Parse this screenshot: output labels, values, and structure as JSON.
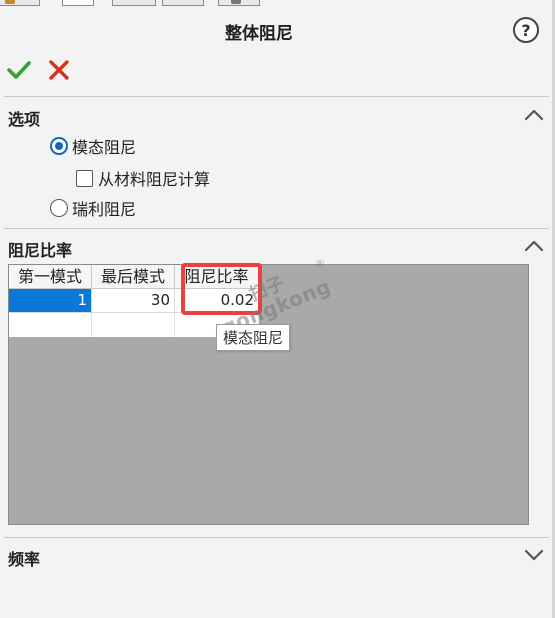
{
  "title": "整体阻尼",
  "help_icon_label": "?",
  "colors": {
    "check_green": "#36a236",
    "cancel_red": "#d8301e",
    "selection_blue": "#0a78d7",
    "highlight_red": "#ee3e3e"
  },
  "sections": {
    "options": {
      "header": "选项",
      "items": {
        "modal_damping": "模态阻尼",
        "from_material": "从材料阻尼计算",
        "rayleigh_damping": "瑞利阻尼"
      },
      "selected": "modal_damping",
      "from_material_checked": false
    },
    "damping_ratio": {
      "header": "阻尼比率",
      "columns": [
        "第一模式",
        "最后模式",
        "阻尼比率"
      ],
      "rows": [
        {
          "first_mode": "1",
          "last_mode": "30",
          "ratio": "0.02"
        }
      ],
      "tooltip": "模态阻尼"
    },
    "frequency": {
      "header": "频率"
    }
  },
  "watermark": {
    "top": "扫子",
    "bottom": "gongkong",
    "reg": "®"
  }
}
